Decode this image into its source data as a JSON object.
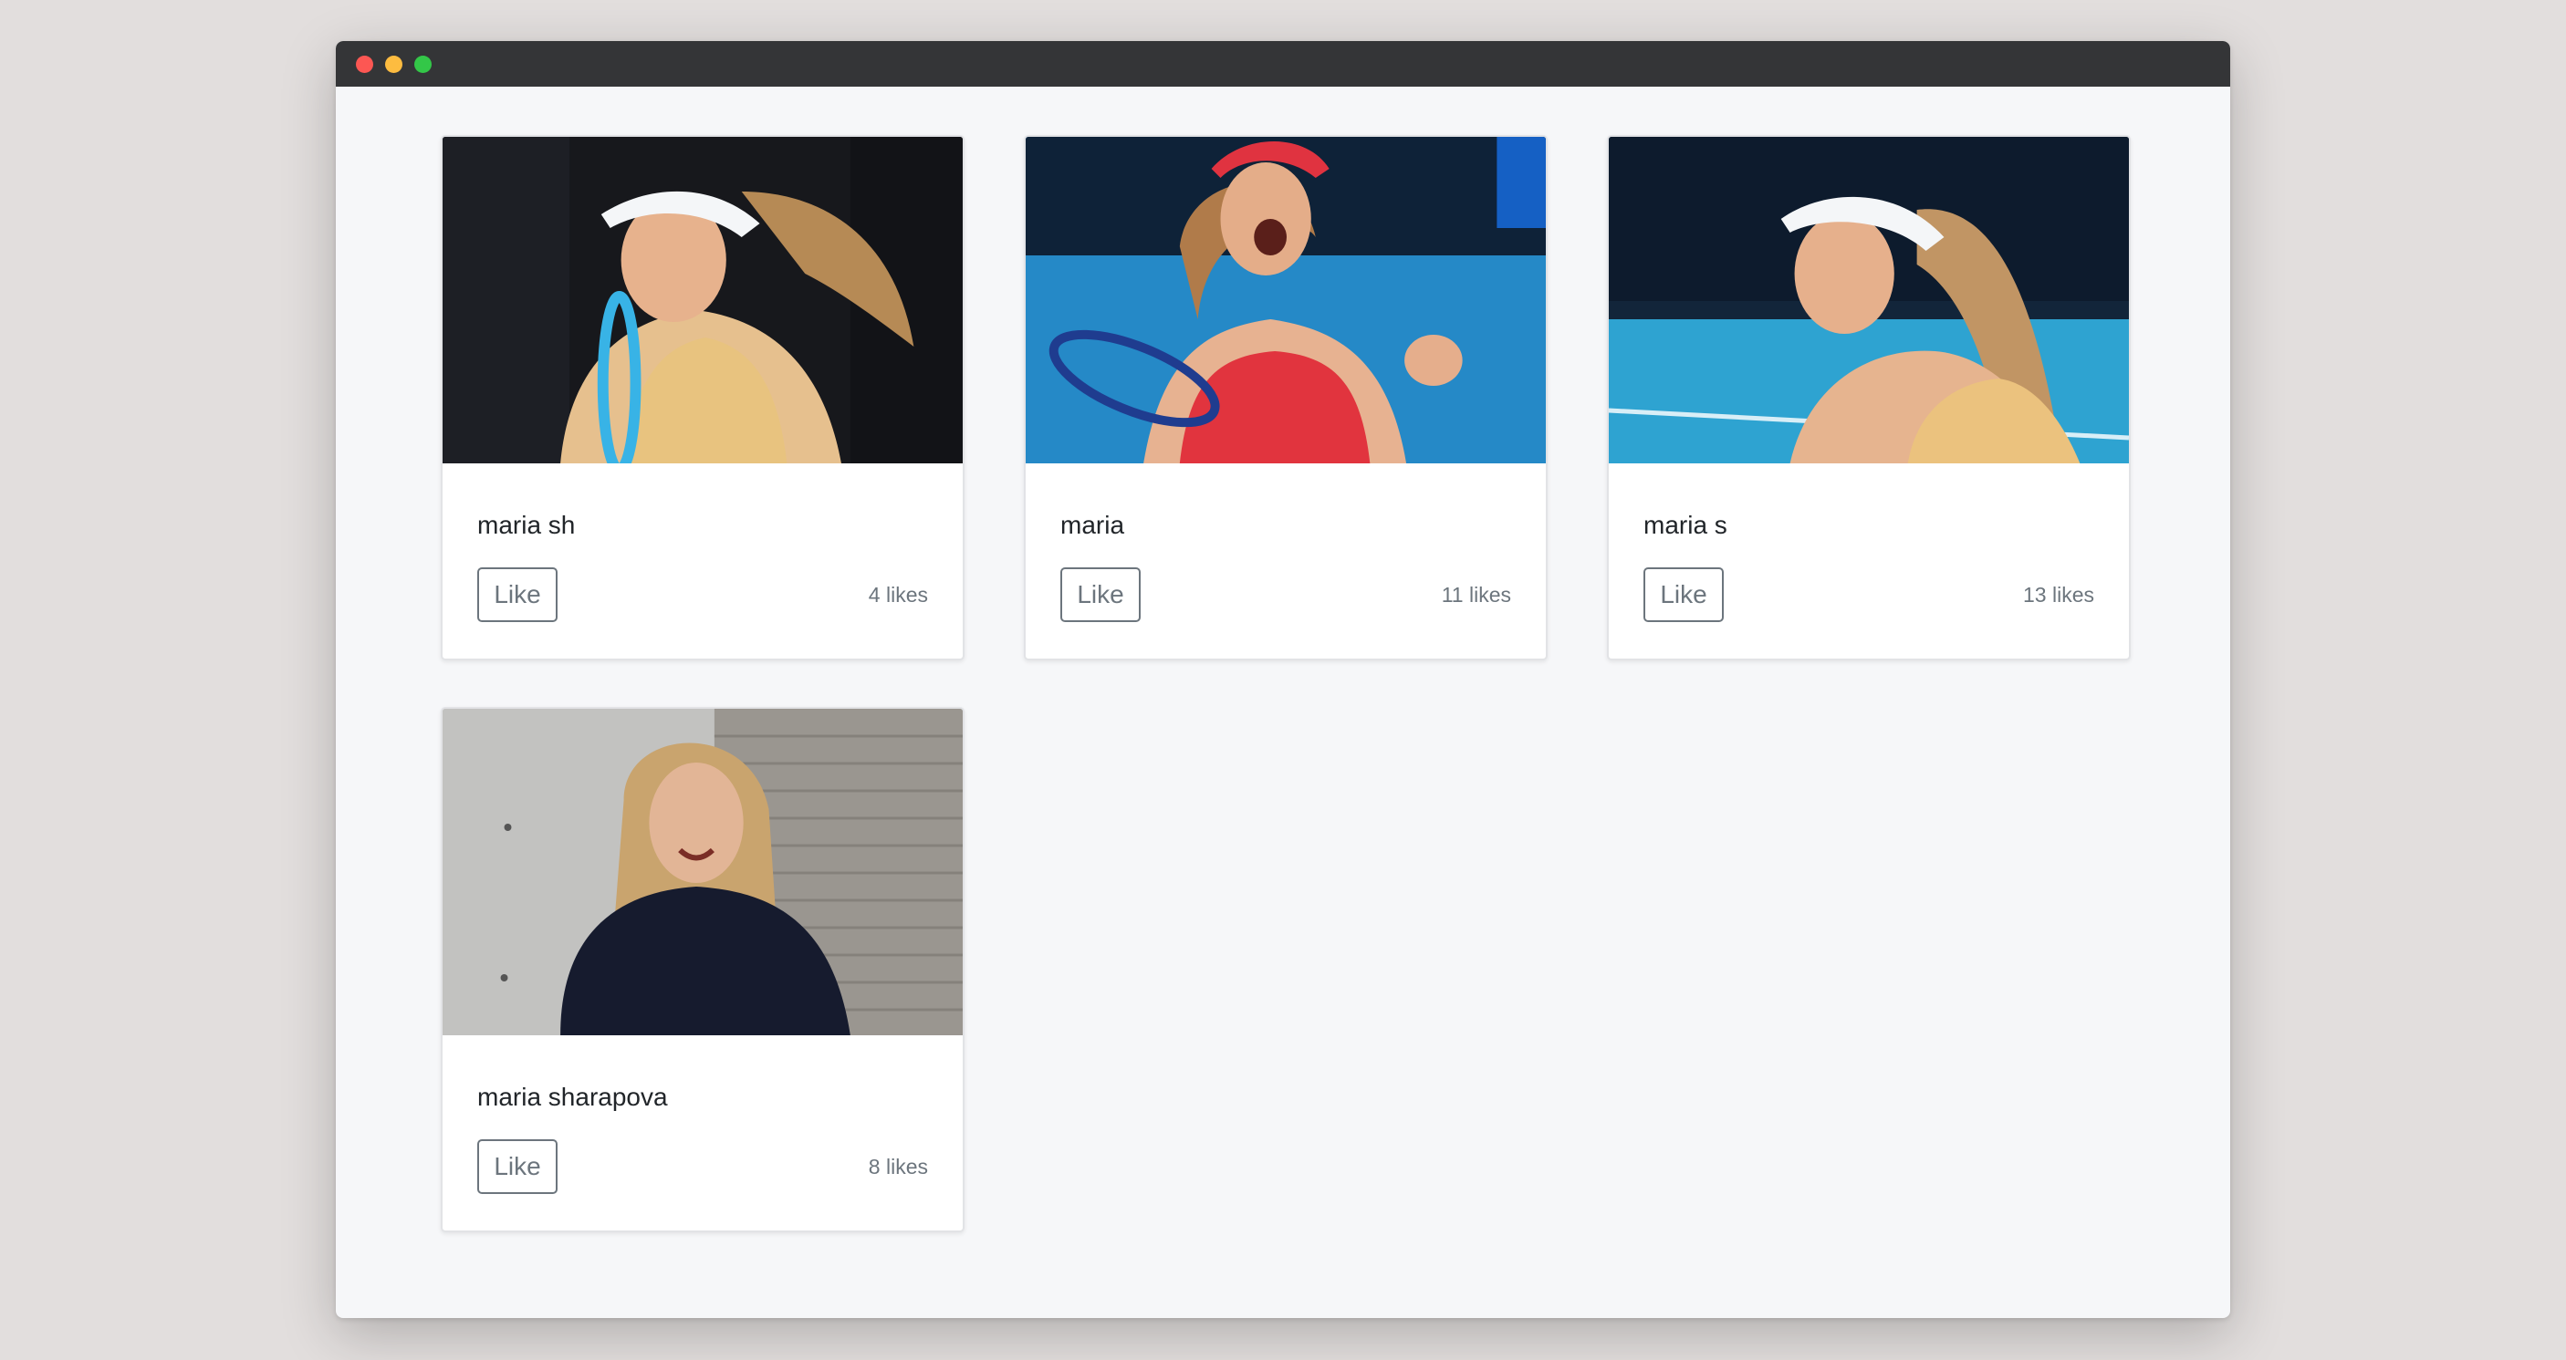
{
  "window": {
    "controls": [
      "close",
      "minimize",
      "maximize"
    ]
  },
  "cards": [
    {
      "title": "maria sh",
      "like_label": "Like",
      "likes_text": "4 likes",
      "image": "woman-with-white-visor-and-racket-photo"
    },
    {
      "title": "maria",
      "like_label": "Like",
      "likes_text": "11 likes",
      "image": "woman-in-red-celebrating-with-racket-photo"
    },
    {
      "title": "maria s",
      "like_label": "Like",
      "likes_text": "13 likes",
      "image": "woman-with-white-visor-on-court-photo"
    },
    {
      "title": "maria sharapova",
      "like_label": "Like",
      "likes_text": "8 likes",
      "image": "woman-smiling-indoors-photo"
    }
  ],
  "colors": {
    "page_background": "#e2dedd",
    "window_background": "#f6f7f9",
    "titlebar": "#343537",
    "button_outline": "#6c757d"
  }
}
